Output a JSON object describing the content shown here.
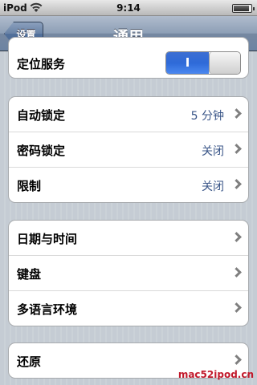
{
  "status_bar": {
    "carrier": "iPod",
    "time": "9:14",
    "wifi_icon": "wifi-icon",
    "battery_icon": "battery-icon",
    "battery_level": 0.9
  },
  "nav": {
    "back_label": "设置",
    "title": "通用"
  },
  "groups": {
    "location": {
      "label": "定位服务",
      "toggle_on_text": "I",
      "toggle_state": "on"
    },
    "lock": {
      "rows": [
        {
          "label": "自动锁定",
          "value": "5 分钟"
        },
        {
          "label": "密码锁定",
          "value": "关闭"
        },
        {
          "label": "限制",
          "value": "关闭"
        }
      ]
    },
    "locale": {
      "rows": [
        {
          "label": "日期与时间"
        },
        {
          "label": "键盘"
        },
        {
          "label": "多语言环境"
        }
      ]
    },
    "reset": {
      "label": "还原"
    }
  },
  "watermark": "mac52ipod.cn",
  "colors": {
    "value_text": "#385487",
    "toggle_on": "#2e6ad8",
    "nav_bar": "#6d84a2",
    "background": "#c5ccd4",
    "watermark": "#c2192b"
  }
}
